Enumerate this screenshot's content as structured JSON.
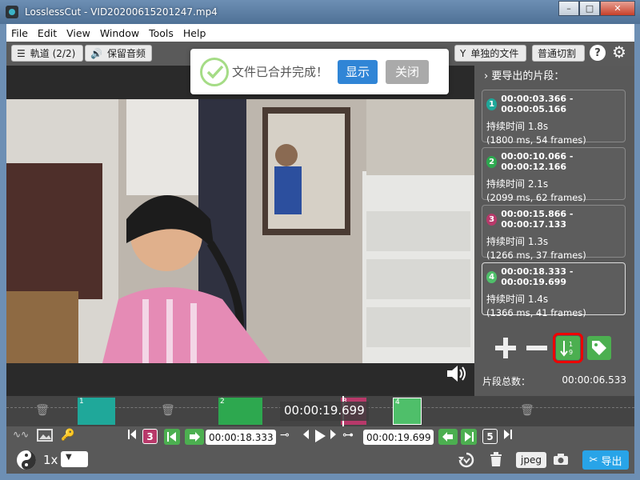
{
  "window": {
    "title": "LosslessCut - VID20200615201247.mp4",
    "minimize_glyph": "–",
    "maximize_glyph": "□",
    "close_glyph": "✕"
  },
  "menu": [
    "File",
    "Edit",
    "View",
    "Window",
    "Tools",
    "Help"
  ],
  "toolbar": {
    "tracks_label": "軌道 (2/2)",
    "audio_label": "保留音频",
    "separate_files_label": "单独的文件",
    "normal_cut_label": "普通切割",
    "help_glyph": "?"
  },
  "toast": {
    "message": "文件已合并完成！",
    "show_label": "显示",
    "close_label": "关闭",
    "colors": {
      "show": "#3085d6",
      "close": "#aaaaaa",
      "check": "#a5dc86"
    }
  },
  "side_panel": {
    "header": "要导出的片段：",
    "segments": [
      {
        "num": "1",
        "range": "00:00:03.366 - 00:00:05.166",
        "duration": "持续时间 1.8s",
        "frames": "(1800 ms, 54 frames)",
        "color": "#1fa89a"
      },
      {
        "num": "2",
        "range": "00:00:10.066 - 00:00:12.166",
        "duration": "持续时间 2.1s",
        "frames": "(2099 ms, 62 frames)",
        "color": "#2da84f"
      },
      {
        "num": "3",
        "range": "00:00:15.866 - 00:00:17.133",
        "duration": "持续时间 1.3s",
        "frames": "(1266 ms, 37 frames)",
        "color": "#b8396a"
      },
      {
        "num": "4",
        "range": "00:00:18.333 - 00:00:19.699",
        "duration": "持续时间 1.4s",
        "frames": "(1366 ms, 41 frames)",
        "color": "#4fbf6a"
      }
    ],
    "total_label": "片段总数：",
    "total_value": "00:00:06.533"
  },
  "timeline": {
    "current_time": "00:00:19.699",
    "segment_labels": [
      "1",
      "2",
      "3",
      "4"
    ]
  },
  "controls": {
    "segment_prev_num": "3",
    "segment_next_num": "5",
    "start_time": "00:00:18.333",
    "end_time": "00:00:19.699"
  },
  "bottom": {
    "speed": "1x",
    "format": "jpeg",
    "export_label": "导出"
  }
}
